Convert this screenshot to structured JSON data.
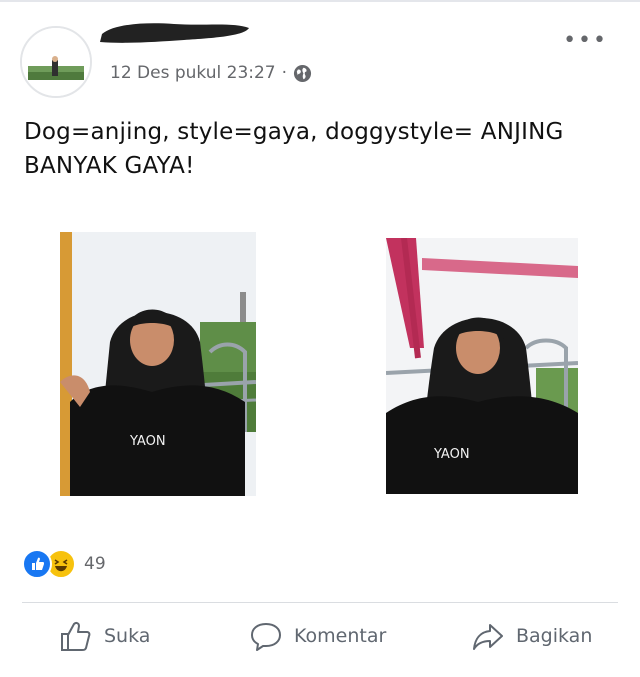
{
  "post": {
    "timestamp": "12 Des pukul 23:27",
    "separator": "·",
    "caption_line1": "Dog=anjing, style=gaya, doggystyle= ANJING",
    "caption_line2": "BANYAK GAYA!",
    "more_label": "•••",
    "reactions": {
      "count": "49",
      "types": [
        "like-icon",
        "haha-icon"
      ]
    },
    "shirt_text_1": "YAON",
    "shirt_text_2": "YAON"
  },
  "actions": {
    "like_label": "Suka",
    "comment_label": "Komentar",
    "share_label": "Bagikan"
  },
  "colors": {
    "like_blue": "#1877f2",
    "haha_yellow": "#f7c20d",
    "muted_text": "#65676b"
  }
}
